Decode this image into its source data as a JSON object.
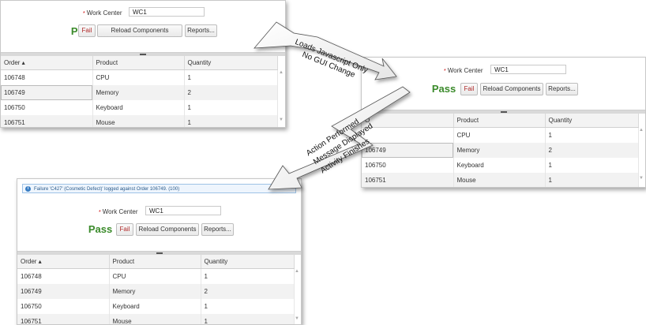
{
  "form": {
    "work_center_label": "Work Center",
    "required_marker": "*",
    "work_center_value": "WC1",
    "pass_label": "Pass",
    "fail_label": "Fail",
    "reload_label": "Reload Components",
    "reports_label": "Reports..."
  },
  "table": {
    "columns": [
      "Order ▴",
      "Product",
      "Quantity"
    ],
    "rows": [
      [
        "106748",
        "CPU",
        "1"
      ],
      [
        "106749",
        "Memory",
        "2"
      ],
      [
        "106750",
        "Keyboard",
        "1"
      ],
      [
        "106751",
        "Mouse",
        "1"
      ]
    ]
  },
  "table_right_first_col": [
    "",
    "106749",
    "106750",
    "106751"
  ],
  "table_right_header_first": "O",
  "message": {
    "text": "Failure 'C427' (Cosmetic Defect)' logged against Order 106749. (100)"
  },
  "callouts": {
    "top_line1": "Loads Javascript Only",
    "top_line2": "No GUI Change",
    "bottom_line1": "Action Performed",
    "bottom_line2": "Message Displayed",
    "bottom_line3": "Activity Finishes"
  },
  "colors": {
    "pass": "#3a8a2a",
    "fail": "#b02a2a",
    "info": "#3a7ec4"
  }
}
